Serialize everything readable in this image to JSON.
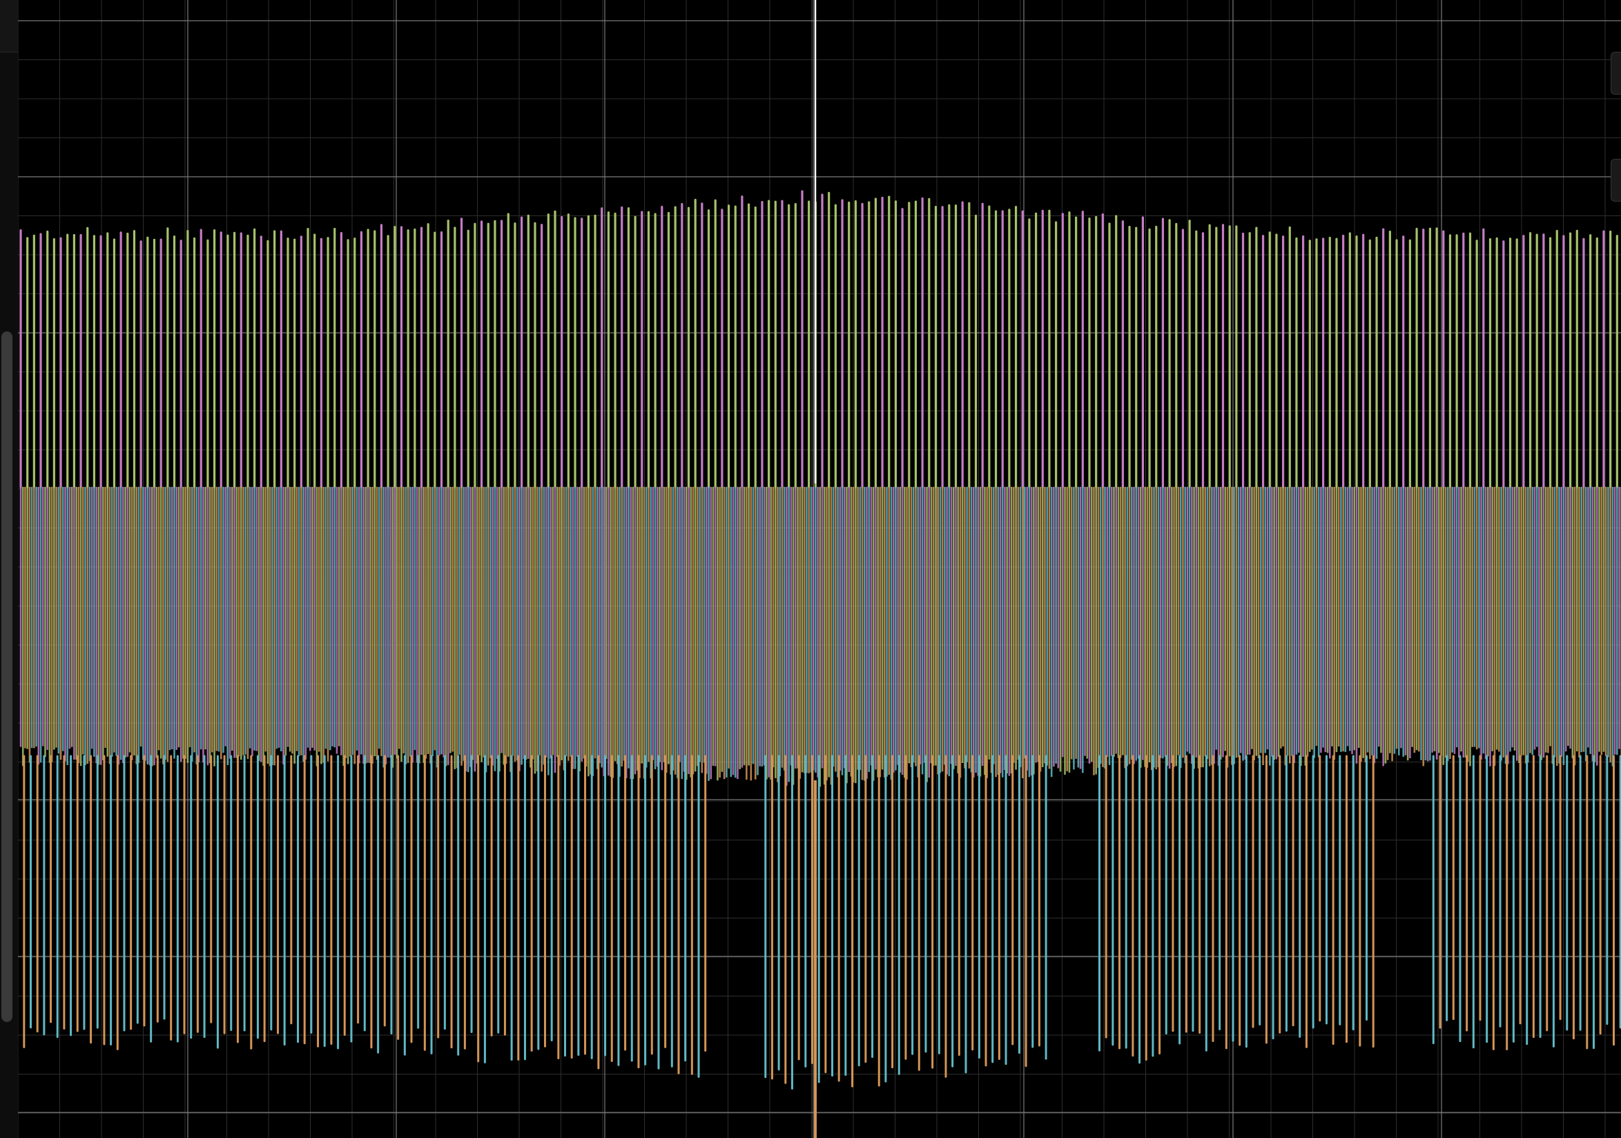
{
  "app": {
    "view": "waveform-display",
    "background": "#000000"
  },
  "colors": {
    "grid_major": "#7a7a7a",
    "grid_minor": "#2e2e2e",
    "cursor": "#ffffff",
    "channels": [
      "#c47dc4",
      "#a6c16a",
      "#d49455",
      "#5fb8c4"
    ]
  },
  "icons": {
    "left_scrollbar": "scrollbar-thumb",
    "right_controls": "panel-handle"
  },
  "chart_data": {
    "type": "line",
    "grid": true,
    "cursor_visible": true,
    "series": [
      {
        "color": "#c47dc4"
      },
      {
        "color": "#a6c16a"
      },
      {
        "color": "#d49455"
      },
      {
        "color": "#5fb8c4"
      }
    ]
  }
}
